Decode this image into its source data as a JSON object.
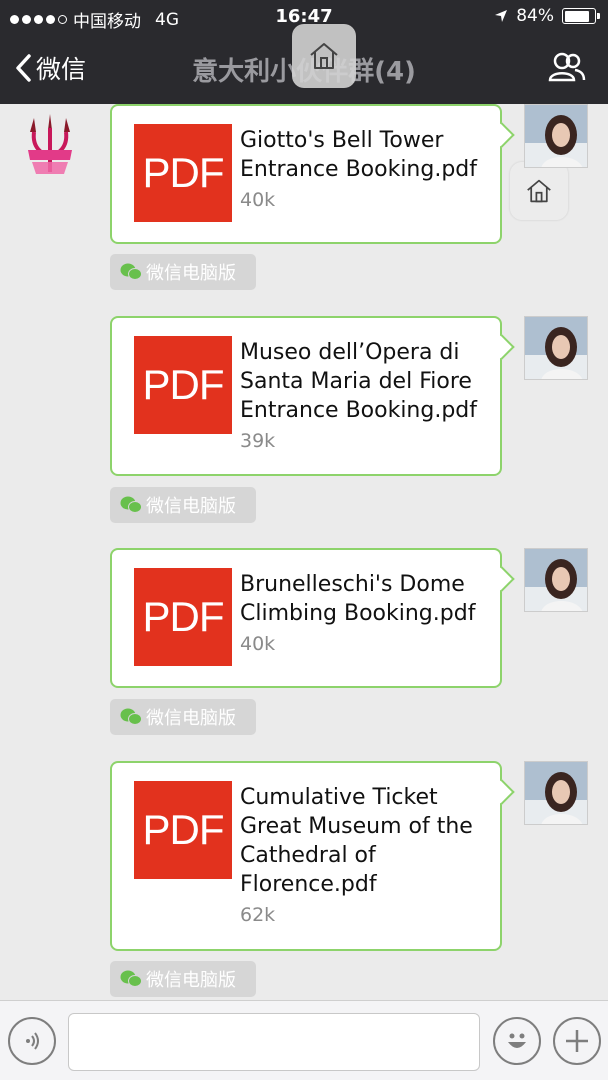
{
  "status_bar": {
    "carrier": "中国移动",
    "network": "4G",
    "time": "16:47",
    "battery": "84%",
    "battery_level": 0.84
  },
  "nav": {
    "back_label": "微信",
    "title": "意大利小伙伴群(4)"
  },
  "messages": [
    {
      "file_name": "Giotto's Bell Tower Entrance Booking.pdf",
      "size": "40k",
      "icon_label": "PDF",
      "source_tag": "微信电脑版"
    },
    {
      "file_name": "Museo dell’Opera di Santa Maria del Fiore Entrance Booking.pdf",
      "size": "39k",
      "icon_label": "PDF",
      "source_tag": "微信电脑版"
    },
    {
      "file_name": "Brunelleschi's Dome Climbing Booking.pdf",
      "size": "40k",
      "icon_label": "PDF",
      "source_tag": "微信电脑版"
    },
    {
      "file_name": "Cumulative Ticket Great Museum of the Cathedral of Florence.pdf",
      "size": "62k",
      "icon_label": "PDF",
      "source_tag": "微信电脑版"
    }
  ],
  "colors": {
    "accent_green": "#8dd36b",
    "pdf_red": "#e2321e",
    "nav_bg": "#2a2a2e"
  }
}
